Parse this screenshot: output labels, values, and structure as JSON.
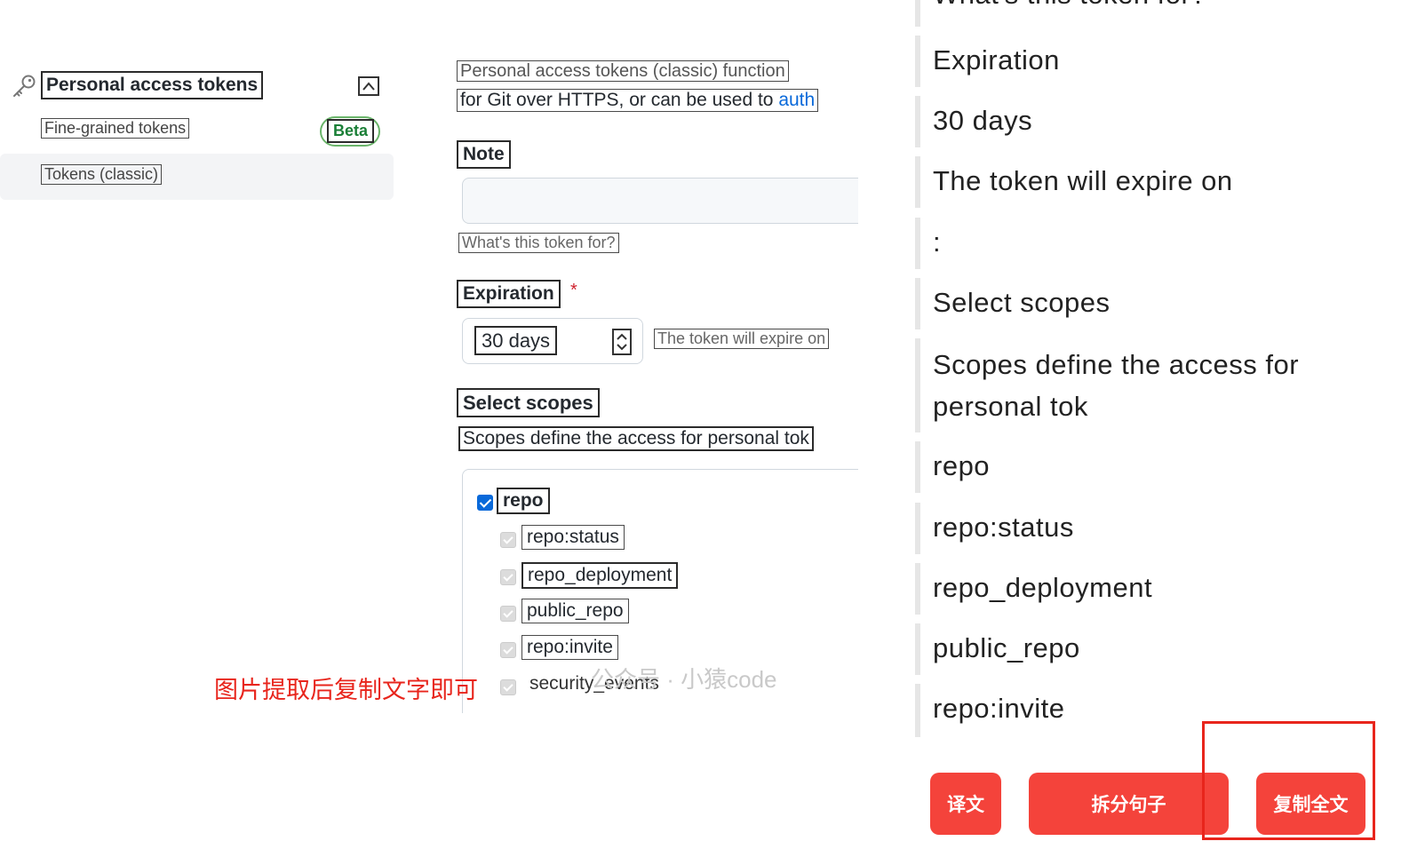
{
  "sidebar": {
    "title": "Personal access tokens",
    "items": [
      {
        "label": "Fine-grained tokens",
        "badge": "Beta"
      },
      {
        "label": "Tokens (classic)",
        "selected": true
      }
    ],
    "icons": {
      "key": "key-icon",
      "collapse": "collapse-icon"
    }
  },
  "form": {
    "desc_line1": "Personal access tokens (classic) function",
    "desc_line2": "for Git over HTTPS, or can be used to ",
    "desc_link": "auth",
    "note_label": "Note",
    "note_placeholder": "What's this token for?",
    "expiration_label": "Expiration",
    "required_mark": "*",
    "expiration_value": "30 days",
    "expire_on_text": "The token will expire on",
    "scopes_label": "Select scopes",
    "scopes_desc": "Scopes define the access for personal tok",
    "scopes": [
      {
        "label": "repo",
        "checked": true
      },
      {
        "label": "repo:status",
        "checked": true
      },
      {
        "label": "repo_deployment",
        "checked": true
      },
      {
        "label": "public_repo",
        "checked": true
      },
      {
        "label": "repo:invite",
        "checked": true
      },
      {
        "label": "security_events",
        "checked": true
      }
    ]
  },
  "watermark": "公众号 · 小猿code",
  "annotation": "图片提取后复制文字即可",
  "extracted": [
    "What's this token for?",
    "Expiration",
    "30 days",
    "The token will expire on",
    ":",
    "Select scopes",
    "Scopes define the access for personal tok",
    "repo",
    "repo:status",
    "repo_deployment",
    "public_repo",
    "repo:invite"
  ],
  "actions": {
    "translate": "译文",
    "split": "拆分句子",
    "copy_all": "复制全文"
  },
  "colors": {
    "action_red": "#f4433b",
    "highlight_red": "#e8251c",
    "link_blue": "#0969da",
    "beta_green": "#1a7f37"
  }
}
